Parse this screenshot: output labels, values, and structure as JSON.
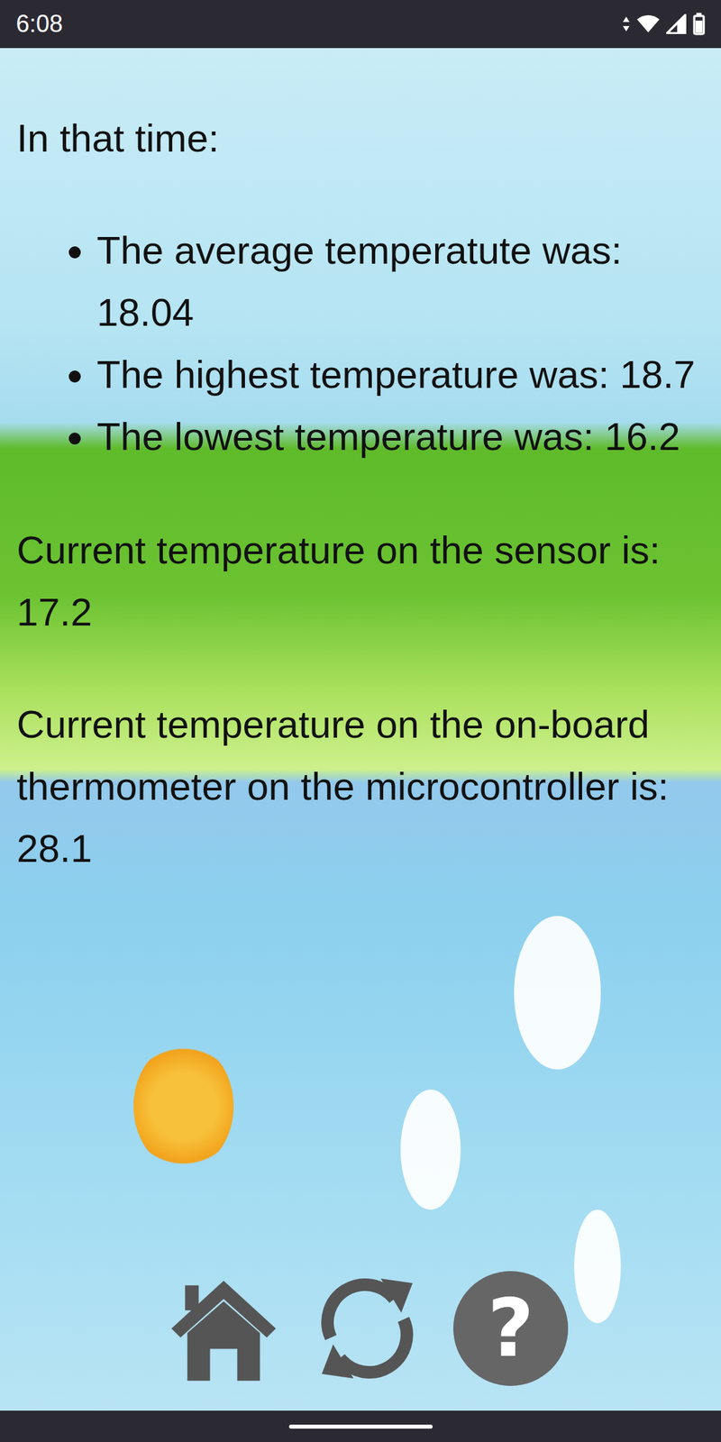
{
  "status_bar": {
    "time": "6:08"
  },
  "intro": "In that time:",
  "stats": [
    "The average temperatute was: 18.04",
    "The highest temperature was: 18.7",
    "The lowest temperature was: 16.2"
  ],
  "readings": [
    "Current temperature on the sensor is: 17.2",
    "Current temperature on the on-board thermometer on the microcontroller is: 28.1"
  ],
  "nav": {
    "help_glyph": "?"
  }
}
